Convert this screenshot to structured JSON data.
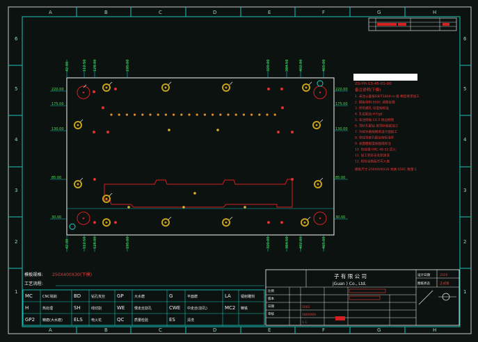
{
  "frame": {
    "columns": [
      "A",
      "B",
      "C",
      "D",
      "E",
      "F",
      "G",
      "H"
    ],
    "rows": [
      "6",
      "5",
      "4",
      "3",
      "2",
      "1"
    ]
  },
  "title_block": {
    "company": "子 有 限 公 司",
    "company_en": "jGuan ) Co., Ltd.",
    "small_labels": [
      "设计日期",
      "图纸状态",
      "比例",
      "版本",
      "日期",
      "审核"
    ],
    "values": [
      "2020",
      "正式版",
      "5001",
      "180000A",
      "1:1"
    ]
  },
  "notes": {
    "header": "ZG-YH-13-45-01-00",
    "subtitle": "备注说明(下模)",
    "lines": [
      "1. 未注公差按GB/T1804-m 级 精度要求加工",
      "2. 模板材料:S50C 调质处理",
      "3. 所有螺孔:深度按标准",
      "4. 孔位配合:H7/g6",
      "5. 未注倒角:C0.5 锐边倒钝",
      "6. 顶针孔配钻 按顶针图纸加工",
      "7. 冷却水路按模具设计图加工",
      "8. 导柱导套孔配合按标准件",
      "9. 表面粗糙度按图纸标注",
      "10. 热处理 HRC 48-52 回火",
      "11. 加工完毕去毛刺清洗",
      "12. 检验合格后方可入库"
    ],
    "footer": "模板尺寸:250X400X30 材质:S50C 数量:1"
  },
  "plate": {
    "spec_label": "模板规格:",
    "spec_value": "250X400X30(下模)",
    "process_label": "工艺流程:"
  },
  "dims_top": [
    "42.00",
    "112.50",
    "128.00",
    "195.00",
    "320.00",
    "384.50",
    "402.00",
    "465.00"
  ],
  "dims_left": [
    "220.00",
    "175.00",
    "130.00",
    "85.00",
    "30.00"
  ],
  "process_table": [
    [
      "MC",
      "CNC铣削",
      "BD",
      "钻孔攻丝",
      "GP",
      "大水磨",
      "G",
      "平面磨",
      "LA",
      "镭射雕刻"
    ],
    [
      "H",
      "热处理",
      "SH",
      "线切割",
      "WE",
      "慢走丝割孔",
      "CWE",
      "中走丝(割孔)",
      "MC2",
      "精铣"
    ],
    [
      "GP2",
      "精磨(大水磨)",
      "ELS",
      "电火花",
      "QC",
      "质量检验",
      "ES",
      "清洗",
      "",
      ""
    ]
  ]
}
